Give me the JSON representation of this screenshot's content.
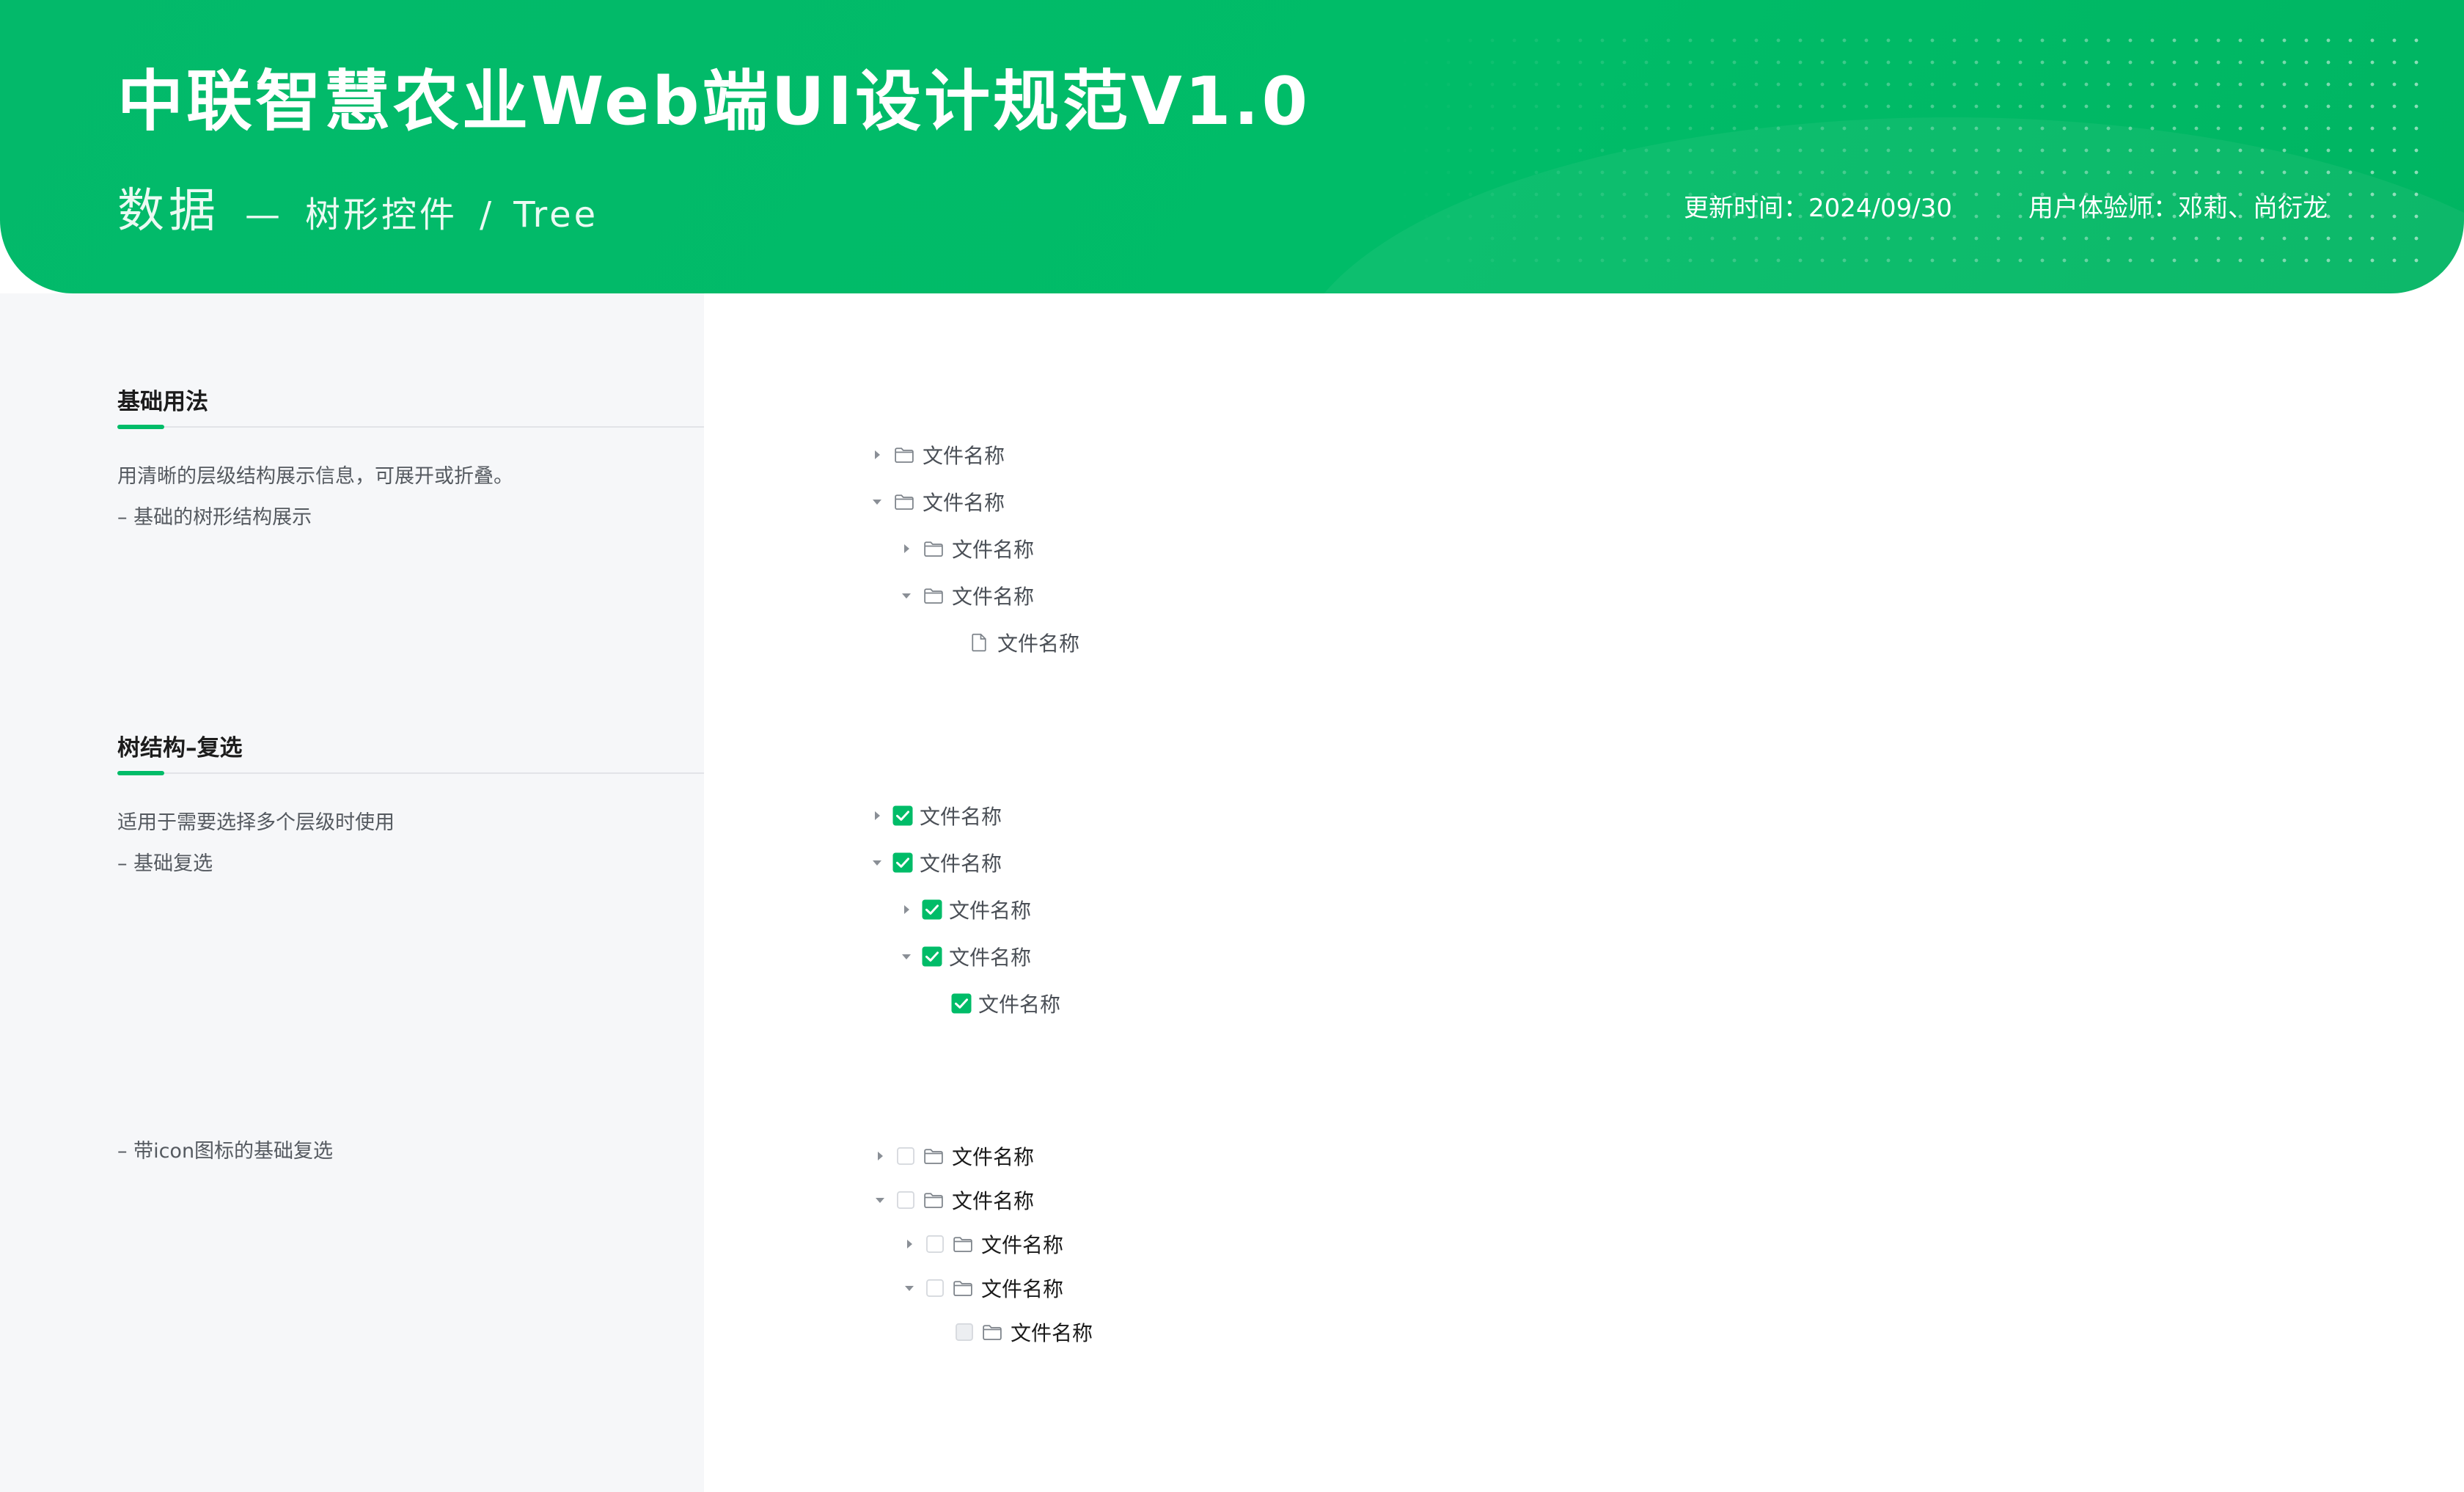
{
  "header": {
    "title": "中联智慧农业Web端UI设计规范V1.0",
    "category": "数据",
    "separator": "—",
    "component_name": "树形控件",
    "slash": "/",
    "component_en": "Tree",
    "update_time": "更新时间：2024/09/30",
    "designer": "用户体验师：邓莉、尚衍龙"
  },
  "colors": {
    "brand": "#00bc68",
    "panel_bg": "#f6f7f9",
    "text_primary": "#1a1a1a",
    "text_secondary": "#555a60"
  },
  "sections": [
    {
      "title": "基础用法",
      "descriptions": [
        "用清晰的层级结构展示信息，可展开或折叠。",
        "– 基础的树形结构展示"
      ]
    },
    {
      "title": "树结构–复选",
      "descriptions": [
        "适用于需要选择多个层级时使用",
        "– 基础复选"
      ]
    },
    {
      "title": "",
      "descriptions": [
        "– 带icon图标的基础复选"
      ]
    }
  ],
  "tree_basic": [
    {
      "label": "文件名称",
      "caret": "collapsed",
      "icon": "folder-icon"
    },
    {
      "label": "文件名称",
      "caret": "expanded",
      "icon": "folder-icon"
    },
    {
      "label": "文件名称",
      "caret": "collapsed",
      "icon": "folder-icon"
    },
    {
      "label": "文件名称",
      "caret": "expanded",
      "icon": "folder-icon"
    },
    {
      "label": "文件名称",
      "caret": "none",
      "icon": "file-icon"
    }
  ],
  "tree_checkbox": [
    {
      "label": "文件名称",
      "caret": "collapsed",
      "checked": true
    },
    {
      "label": "文件名称",
      "caret": "expanded",
      "checked": true
    },
    {
      "label": "文件名称",
      "caret": "collapsed",
      "checked": true
    },
    {
      "label": "文件名称",
      "caret": "expanded",
      "checked": true
    },
    {
      "label": "文件名称",
      "caret": "none",
      "checked": true
    }
  ],
  "tree_checkbox_icon": [
    {
      "label": "文件名称",
      "caret": "collapsed",
      "checked": false,
      "icon": "folder-icon"
    },
    {
      "label": "文件名称",
      "caret": "expanded",
      "checked": false,
      "icon": "folder-icon"
    },
    {
      "label": "文件名称",
      "caret": "collapsed",
      "checked": false,
      "icon": "folder-icon"
    },
    {
      "label": "文件名称",
      "caret": "expanded",
      "checked": false,
      "icon": "folder-icon"
    },
    {
      "label": "文件名称",
      "caret": "none",
      "checked": false,
      "disabled": true,
      "icon": "folder-icon"
    }
  ]
}
